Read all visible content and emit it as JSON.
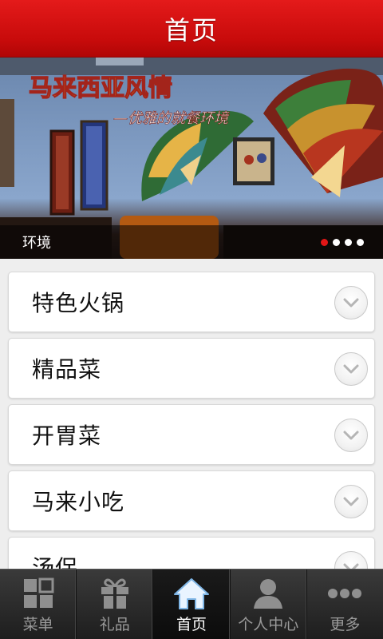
{
  "header": {
    "title": "首页"
  },
  "banner": {
    "caption": "环境",
    "slogan_title": "马来西亚风情",
    "slogan_sub": "—优雅的就餐环境",
    "slide_count": 4,
    "active_slide": 1
  },
  "categories": [
    {
      "label": "特色火锅"
    },
    {
      "label": "精品菜"
    },
    {
      "label": "开胃菜"
    },
    {
      "label": "马来小吃"
    },
    {
      "label": "汤保"
    }
  ],
  "tabbar": {
    "items": [
      {
        "label": "菜单",
        "icon": "grid-icon"
      },
      {
        "label": "礼品",
        "icon": "gift-icon"
      },
      {
        "label": "首页",
        "icon": "home-icon",
        "active": true
      },
      {
        "label": "个人中心",
        "icon": "user-icon"
      },
      {
        "label": "更多",
        "icon": "more-dots-icon"
      }
    ]
  },
  "colors": {
    "accent": "#d41212",
    "tab_bg": "#2a2a2a"
  }
}
